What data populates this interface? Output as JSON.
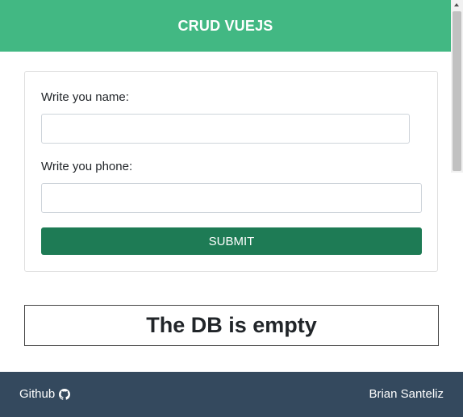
{
  "navbar": {
    "title": "CRUD VUEJS",
    "color": "#42b883"
  },
  "form": {
    "name_label": "Write you name:",
    "name_value": "",
    "phone_label": "Write you phone:",
    "phone_value": "",
    "submit_label": "SUBMIT",
    "submit_color": "#1e7b55"
  },
  "db_status": {
    "message": "The DB is empty"
  },
  "footer": {
    "github_label": "Github",
    "github_icon": "github-icon",
    "author": "Brian Santeliz",
    "color": "#34495e"
  }
}
